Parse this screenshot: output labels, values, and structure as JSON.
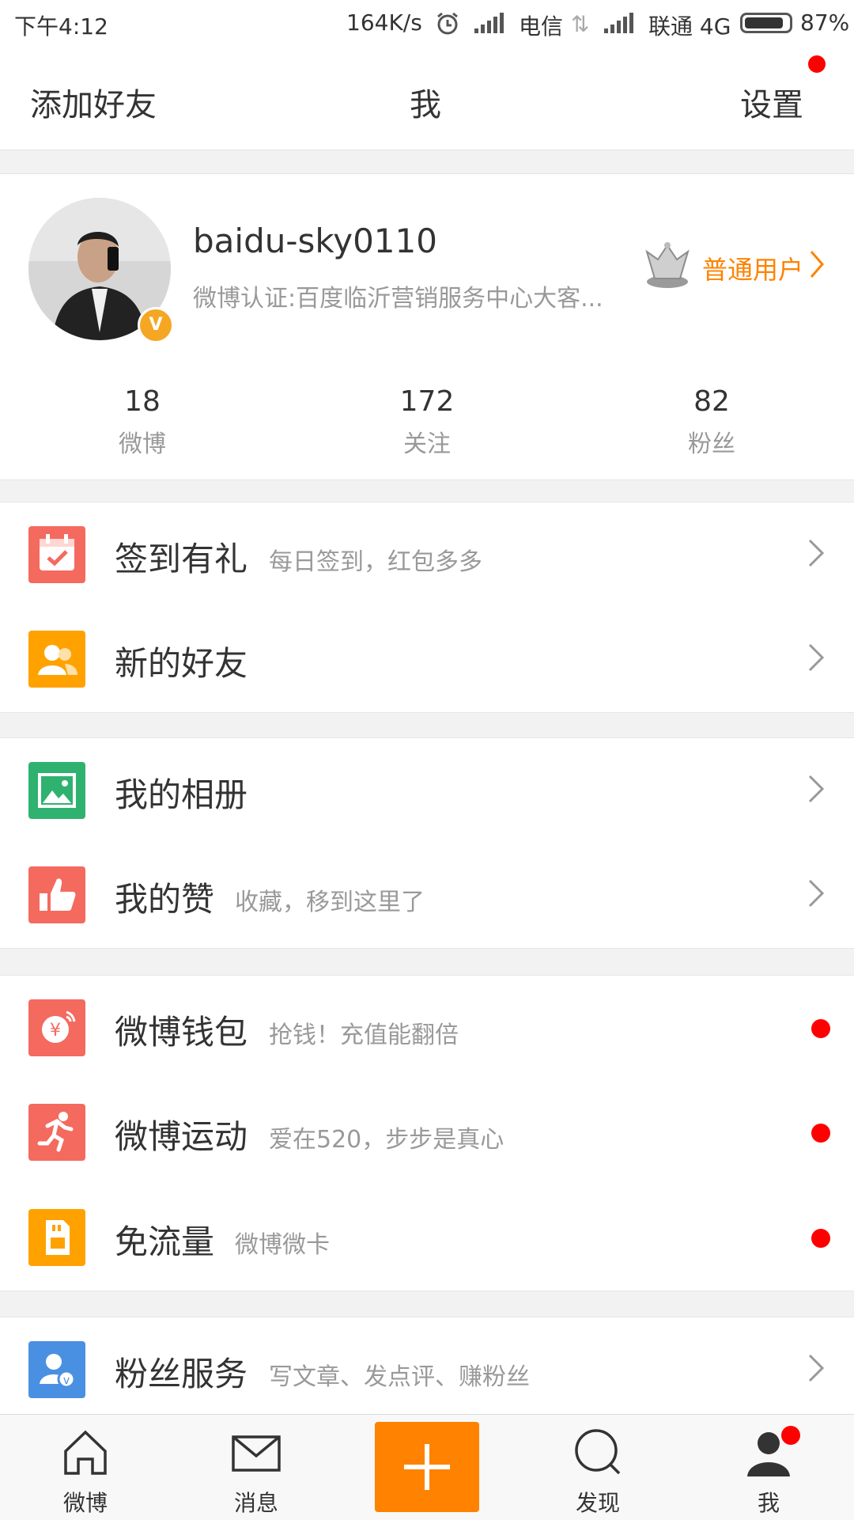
{
  "status_bar": {
    "time": "下午4:12",
    "speed": "164K/s",
    "carrier1": "电信",
    "carrier2": "联通 4G",
    "battery": "87%"
  },
  "header": {
    "add_friend": "添加好友",
    "title": "我",
    "settings": "设置"
  },
  "profile": {
    "username": "baidu-sky0110",
    "verification": "微博认证:百度临沂营销服务中心大客...",
    "user_level": "普通用户"
  },
  "stats": [
    {
      "value": "18",
      "label": "微博"
    },
    {
      "value": "172",
      "label": "关注"
    },
    {
      "value": "82",
      "label": "粉丝"
    }
  ],
  "menu": [
    {
      "title": "签到有礼",
      "subtitle": "每日签到，红包多多",
      "icon": "calendar-check-icon",
      "color": "#f46a5f"
    },
    {
      "title": "新的好友",
      "subtitle": "",
      "icon": "friends-icon",
      "color": "#ffa200"
    },
    {
      "title": "我的相册",
      "subtitle": "",
      "icon": "photo-album-icon",
      "color": "#2fb26f"
    },
    {
      "title": "我的赞",
      "subtitle": "收藏，移到这里了",
      "icon": "thumbs-up-icon",
      "color": "#f46a5f"
    },
    {
      "title": "微博钱包",
      "subtitle": "抢钱！充值能翻倍",
      "icon": "wallet-icon",
      "color": "#f46a5f"
    },
    {
      "title": "微博运动",
      "subtitle": "爱在520，步步是真心",
      "icon": "running-icon",
      "color": "#f46a5f"
    },
    {
      "title": "免流量",
      "subtitle": "微博微卡",
      "icon": "sim-card-icon",
      "color": "#ffa200"
    },
    {
      "title": "粉丝服务",
      "subtitle": "写文章、发点评、赚粉丝",
      "icon": "fan-service-icon",
      "color": "#4a90e2"
    }
  ],
  "tabbar": {
    "home": "微博",
    "messages": "消息",
    "discover": "发现",
    "me": "我"
  }
}
